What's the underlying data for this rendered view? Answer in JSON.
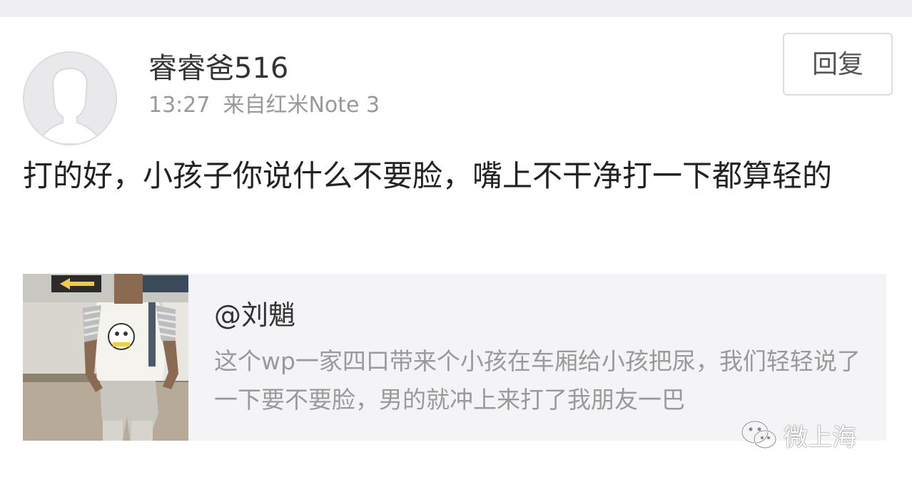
{
  "post": {
    "username": "睿睿爸516",
    "time": "13:27",
    "source": "来自红米Note 3",
    "reply_label": "回复",
    "comment": "打的好，小孩子你说什么不要脸，嘴上不干净打一下都算轻的"
  },
  "quote": {
    "author": "@刘魈",
    "text": "这个wp一家四口带来个小孩在车厢给小孩把尿，我们轻轻说了一下要不要脸，男的就冲上来打了我朋友一巴"
  },
  "watermark": {
    "icon": "wechat-icon",
    "text": "微上海"
  },
  "colors": {
    "background": "#ffffff",
    "top_strip": "#f0f0f2",
    "quote_background": "#f4f4f6",
    "username": "#333333",
    "meta": "#999999",
    "quote_text": "#9a9a9a"
  }
}
